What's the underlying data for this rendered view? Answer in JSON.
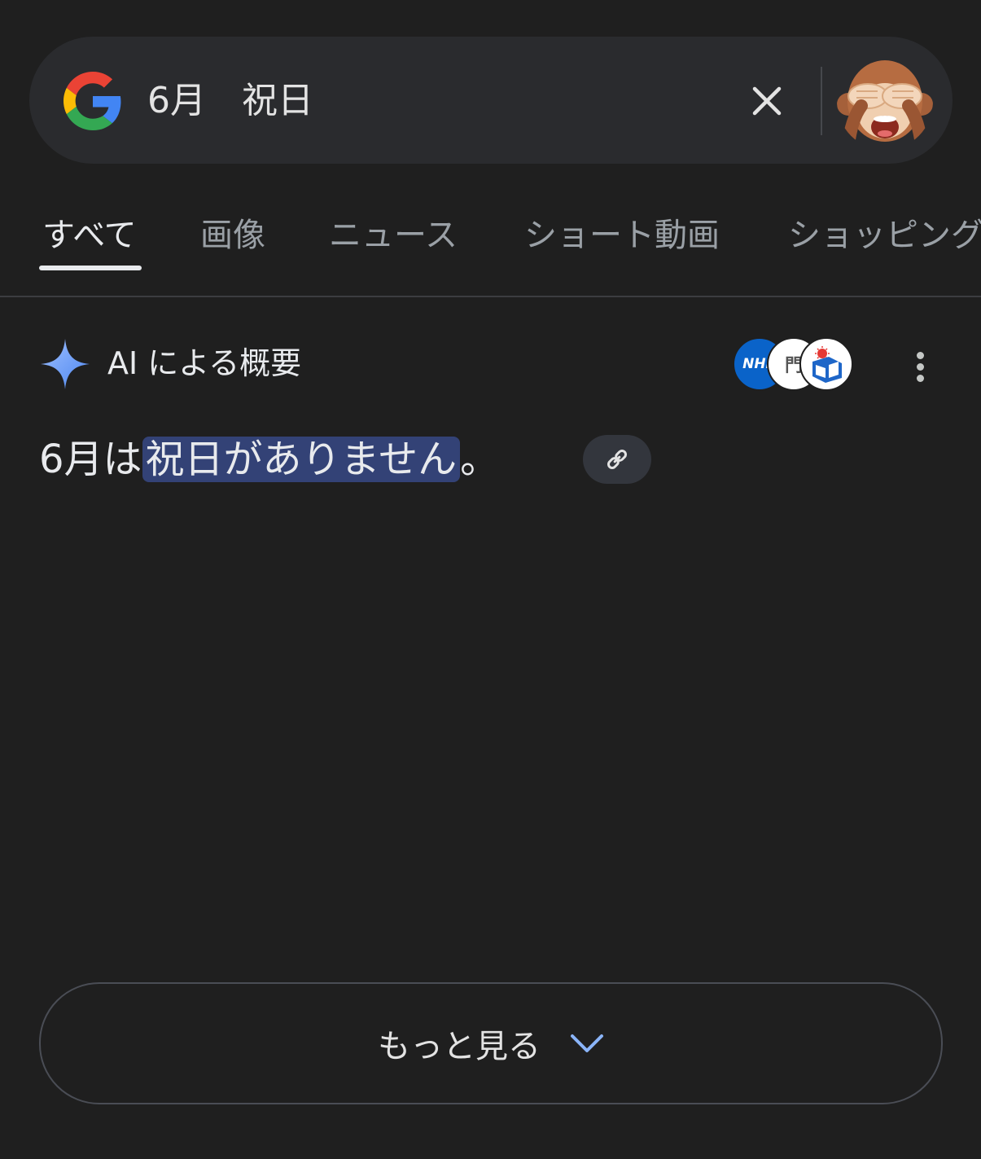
{
  "search": {
    "query": "6月　祝日",
    "clear_icon": "close-icon",
    "avatar_icon": "see-no-evil-monkey-emoji"
  },
  "tabs": [
    {
      "label": "すべて",
      "active": true
    },
    {
      "label": "画像"
    },
    {
      "label": "ニュース"
    },
    {
      "label": "ショート動画"
    },
    {
      "label": "ショッピング"
    }
  ],
  "ai_overview": {
    "title": "AI による概要",
    "icon": "sparkle-icon",
    "sources": [
      {
        "label": "NHK",
        "color": "#0a63c9"
      },
      {
        "label": "門"
      },
      {
        "label": "calendar"
      }
    ],
    "answer_prefix": "6月は",
    "answer_highlight": "祝日がありません",
    "answer_suffix": "。",
    "link_icon": "link-icon",
    "highlight_color": "#334276"
  },
  "show_more": {
    "label": "もっと見る",
    "icon": "chevron-down-icon",
    "icon_color": "#8ab4f8"
  }
}
